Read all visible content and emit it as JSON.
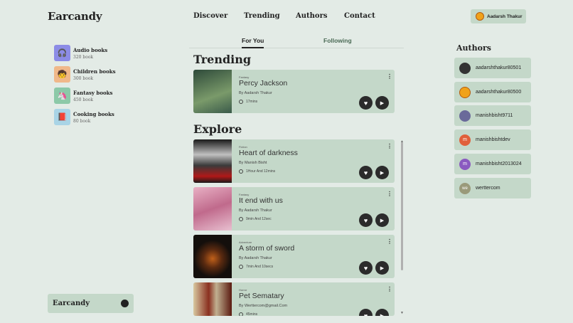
{
  "header": {
    "logo": "Earcandy",
    "nav": [
      "Discover",
      "Trending",
      "Authors",
      "Contact"
    ],
    "user_name": "Aadarsh Thakur"
  },
  "categories": [
    {
      "title": "Audio books",
      "count": "320 book",
      "icon": "headphones-icon",
      "color": "#8c8ce6",
      "glyph": "🎧"
    },
    {
      "title": "Children books",
      "count": "300 book",
      "icon": "child-icon",
      "color": "#f0b88a",
      "glyph": "🧒"
    },
    {
      "title": "Fantasy books",
      "count": "450 book",
      "icon": "unicorn-icon",
      "color": "#8cc9a8",
      "glyph": "🦄"
    },
    {
      "title": "Cooking books",
      "count": "80 book",
      "icon": "book-icon",
      "color": "#a9d4e6",
      "glyph": "📕"
    }
  ],
  "footer_logo": "Earcandy",
  "tabs": {
    "for_you": "For You",
    "following": "Following"
  },
  "sections": {
    "trending": "Trending",
    "explore": "Explore"
  },
  "trending": [
    {
      "genre": "Fantasy",
      "title": "Percy Jackson",
      "author": "By Aadarsh Thakur",
      "time": "17mins",
      "cover": "#4a6b55"
    }
  ],
  "explore": [
    {
      "genre": "Fiction",
      "title": "Heart of darkness",
      "author": "By Manish Bisht",
      "time": "1Hour And 12mins",
      "cover": "#2a2a2a"
    },
    {
      "genre": "Fantasy",
      "title": "It end with us",
      "author": "By Aadarsh Thakur",
      "time": "9min And 12sec",
      "cover": "#d59ab0"
    },
    {
      "genre": "Adventure",
      "title": "A storm of sword",
      "author": "By Aadarsh Thakur",
      "time": "7min And 10secs",
      "cover": "#1a1612"
    },
    {
      "genre": "Horror",
      "title": "Pet Sematary",
      "author": "By Werttercom@gmail.Com",
      "time": "45mins",
      "cover": "#8a3020"
    }
  ],
  "authors_title": "Authors",
  "authors": [
    {
      "name": "aadarshthakur80501",
      "color": "#333",
      "initial": ""
    },
    {
      "name": "aadarshthakur80500",
      "color": "#f0a21a",
      "initial": ""
    },
    {
      "name": "manishbisht9711",
      "color": "#6a6a9a",
      "initial": ""
    },
    {
      "name": "manishbishtdev",
      "color": "#e0603a",
      "initial": "m"
    },
    {
      "name": "manishbisht2013024",
      "color": "#8a5ac0",
      "initial": "m"
    },
    {
      "name": "werttercom",
      "color": "#9a9a7a",
      "initial": "we"
    }
  ],
  "colors": {
    "card": "#c4d8c9",
    "bg": "#e3ebe6",
    "button": "#2b2b2b"
  }
}
